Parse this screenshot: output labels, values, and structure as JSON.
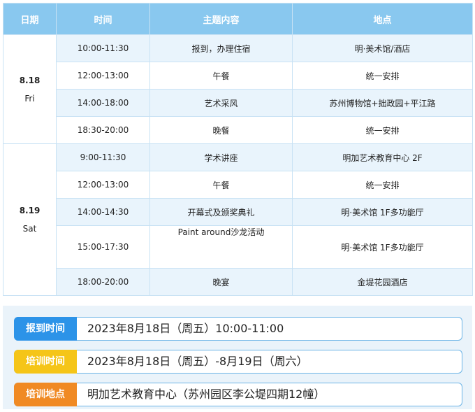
{
  "table": {
    "headers": [
      "日期",
      "时间",
      "主题内容",
      "地点"
    ],
    "days": [
      {
        "date": "8.18",
        "weekday": "Fri",
        "rows": [
          {
            "time": "10:00-11:30",
            "topic": "报到，办理住宿",
            "place": "明·美术馆/酒店"
          },
          {
            "time": "12:00-13:00",
            "topic": "午餐",
            "place": "统一安排"
          },
          {
            "time": "14:00-18:00",
            "topic": "艺术采风",
            "place": "苏州博物馆+拙政园+平江路"
          },
          {
            "time": "18:30-20:00",
            "topic": "晚餐",
            "place": "统一安排"
          }
        ]
      },
      {
        "date": "8.19",
        "weekday": "Sat",
        "rows": [
          {
            "time": "9:00-11:30",
            "topic": "学术讲座",
            "place": "明加艺术教育中心 2F"
          },
          {
            "time": "12:00-13:00",
            "topic": "午餐",
            "place": "统一安排"
          },
          {
            "time": "14:00-14:30",
            "topic": "开幕式及颁奖典礼",
            "place": "明·美术馆 1F多功能厅"
          },
          {
            "time": "15:00-17:30",
            "topic": "Paint around沙龙活动",
            "place": "明·美术馆 1F多功能厅"
          },
          {
            "time": "18:00-20:00",
            "topic": "晚宴",
            "place": "金堤花园酒店"
          }
        ]
      }
    ]
  },
  "info": [
    {
      "label": "报到时间",
      "value": "2023年8月18日（周五）10:00-11:00",
      "color": "#2c93e8"
    },
    {
      "label": "培训时间",
      "value": "2023年8月18日（周五）-8月19日（周六）",
      "color": "#f5c518"
    },
    {
      "label": "培训地点",
      "value": "明加艺术教育中心（苏州园区李公堤四期12幢）",
      "color": "#f08a24"
    }
  ]
}
